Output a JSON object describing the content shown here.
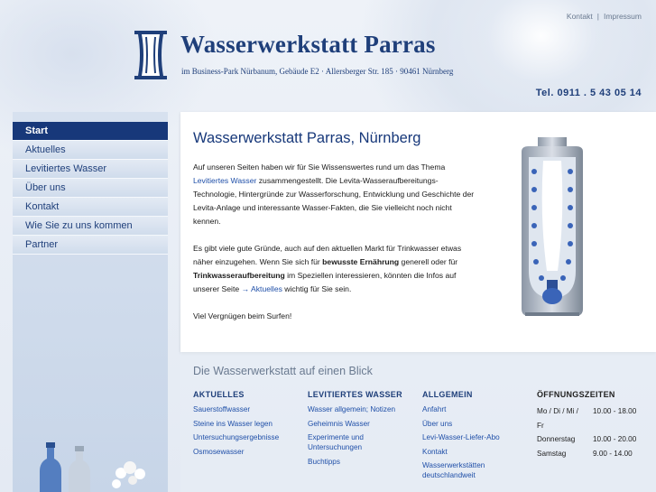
{
  "toplinks": {
    "kontakt": "Kontakt",
    "separator": "|",
    "impressum": "Impressum"
  },
  "header": {
    "brand": "Wasserwerkstatt Parras",
    "address": "im Business-Park Nürbanum, Gebäude E2 · Allersberger Str. 185 · 90461 Nürnberg",
    "phone": "Tel. 0911 . 5 43 05 14"
  },
  "nav": {
    "items": [
      {
        "label": "Start",
        "active": true
      },
      {
        "label": "Aktuelles"
      },
      {
        "label": "Levitiertes Wasser"
      },
      {
        "label": "Über uns"
      },
      {
        "label": "Kontakt"
      },
      {
        "label": "Wie Sie zu uns kommen"
      },
      {
        "label": "Partner"
      }
    ]
  },
  "main": {
    "title": "Wasserwerkstatt Parras, Nürnberg",
    "p1_a": "Auf unseren Seiten haben wir für Sie Wissenswertes rund um das Thema ",
    "p1_link": "Levitiertes Wasser",
    "p1_b": " zusammengestellt. Die Levita-Wasseraufbereitungs-Technologie, Hintergründe zur Wasserforschung, Entwicklung und Geschichte der Levita-Anlage und interessante Wasser-Fakten, die Sie vielleicht noch nicht kennen.",
    "p2_a": "Es gibt viele gute Gründe, auch auf den aktuellen Markt für Trinkwasser etwas näher einzugehen. Wenn Sie sich für ",
    "p2_bold1": "bewusste Ernährung",
    "p2_b": " generell oder für ",
    "p2_bold2": "Trinkwasseraufbereitung",
    "p2_c": " im Speziellen interessieren, könnten die Infos auf unserer Seite ",
    "p2_link": "→ Aktuelles",
    "p2_d": " wichtig für Sie sein.",
    "p3": "Viel Vergnügen beim Surfen!"
  },
  "glance": {
    "title": "Die Wasserwerkstatt auf einen Blick",
    "columns": [
      {
        "head": "AKTUELLES",
        "links": [
          "Sauerstoffwasser",
          "Steine ins Wasser legen",
          "Untersuchungsergebnisse",
          "Osmosewasser"
        ]
      },
      {
        "head": "LEVITIERTES WASSER",
        "links": [
          "Wasser allgemein; Notizen",
          "Geheimnis Wasser",
          "Experimente und Untersuchungen",
          "Buchtipps"
        ]
      },
      {
        "head": "ALLGEMEIN",
        "links": [
          "Anfahrt",
          "Über uns",
          "Levi-Wasser-Liefer-Abo",
          "Kontakt",
          "Wasserwerkstätten deutschlandweit"
        ]
      }
    ],
    "hours": {
      "head": "ÖFFNUNGSZEITEN",
      "rows": [
        {
          "day": "Mo / Di / Mi /",
          "time": "10.00 - 18.00"
        },
        {
          "day": "Fr",
          "time": ""
        },
        {
          "day": "Donnerstag",
          "time": "10.00 - 20.00"
        },
        {
          "day": "Samstag",
          "time": "9.00 - 14.00"
        }
      ]
    }
  },
  "colors": {
    "brand": "#1f3f7a",
    "nav_active": "#17387a",
    "link": "#1f4fa8"
  }
}
